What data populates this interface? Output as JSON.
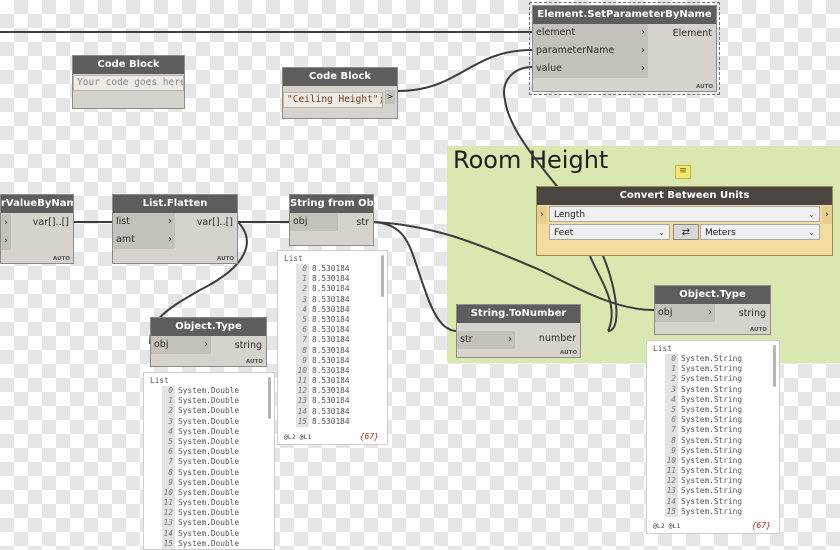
{
  "group": {
    "title": "Room Height",
    "note_icon": "note-icon"
  },
  "nodes": {
    "set_param": {
      "title": "Element.SetParameterByName",
      "inputs": [
        "element",
        "parameterName",
        "value"
      ],
      "output": "Element",
      "lacing": "AUTO"
    },
    "code_block_empty": {
      "title": "Code Block",
      "placeholder": "Your code goes here"
    },
    "code_block_ceiling": {
      "title": "Code Block",
      "code": "\"Ceiling Height\";",
      "output": ">"
    },
    "value_by_name": {
      "title": "rValueByName",
      "output": "var[]..[]",
      "lacing": "AUTO"
    },
    "list_flatten": {
      "title": "List.Flatten",
      "inputs": [
        "list",
        "amt"
      ],
      "output": "var[]..[]",
      "lacing": "AUTO"
    },
    "string_from_object": {
      "title": "String from Object",
      "input": "obj",
      "output": "str"
    },
    "object_type_left": {
      "title": "Object.Type",
      "input": "obj",
      "output": "string",
      "lacing": "AUTO"
    },
    "string_to_number": {
      "title": "String.ToNumber",
      "input": "str",
      "output": "number",
      "lacing": "AUTO"
    },
    "object_type_right": {
      "title": "Object.Type",
      "input": "obj",
      "output": "string",
      "lacing": "AUTO"
    },
    "convert_units": {
      "title": "Convert Between Units",
      "measure": "Length",
      "from_unit": "Feet",
      "to_unit": "Meters",
      "swap_icon": "swap-icon"
    }
  },
  "previews": {
    "left": {
      "label": "List",
      "type_text": "System.Double",
      "indices": [
        "0",
        "1",
        "2",
        "3",
        "4",
        "5",
        "6",
        "7",
        "8",
        "9",
        "10",
        "11",
        "12",
        "13",
        "14",
        "15"
      ]
    },
    "middle": {
      "label": "List",
      "items": [
        [
          "0",
          "8.530184"
        ],
        [
          "1",
          "8.530184"
        ],
        [
          "2",
          "8.530184"
        ],
        [
          "3",
          "8.530184"
        ],
        [
          "4",
          "8.530184"
        ],
        [
          "5",
          "8.530184"
        ],
        [
          "6",
          "8.530184"
        ],
        [
          "7",
          "8.530184"
        ],
        [
          "8",
          "8.530184"
        ],
        [
          "9",
          "8.530184"
        ],
        [
          "10",
          "8.530184"
        ],
        [
          "11",
          "8.530184"
        ],
        [
          "12",
          "8.530184"
        ],
        [
          "13",
          "8.530184"
        ],
        [
          "14",
          "8.530184"
        ],
        [
          "15",
          "8.530184"
        ]
      ],
      "footer": "@L2 @L1",
      "count": "{67}"
    },
    "right": {
      "label": "List",
      "type_text": "System.String",
      "indices": [
        "0",
        "1",
        "2",
        "3",
        "4",
        "5",
        "6",
        "7",
        "8",
        "9",
        "10",
        "11",
        "12",
        "13",
        "14",
        "15"
      ],
      "footer": "@L2 @L1",
      "count": "{67}"
    }
  }
}
